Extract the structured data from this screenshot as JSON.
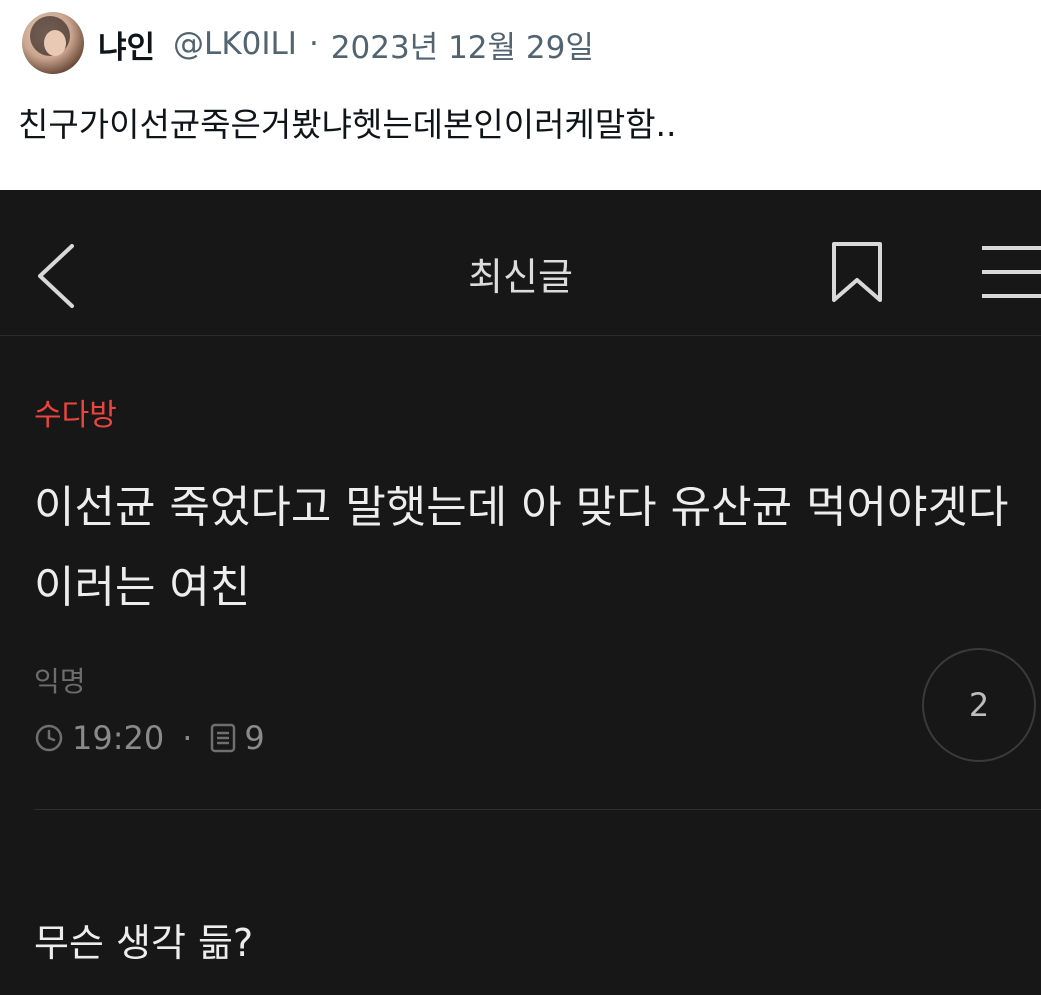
{
  "tweet": {
    "name": "냐인",
    "handle": "@LK0ILI",
    "separator": "·",
    "date": "2023년 12월 29일",
    "text": "친구가이선균죽은거봤냐헷는데본인이러케말함.."
  },
  "app": {
    "header_title": "최신글",
    "post": {
      "category": "수다방",
      "title": "이선균 죽었다고 말햇는데 아 맞다 유산균 먹어야겟다 이러는 여친",
      "author": "익명",
      "time": "19:20",
      "meta_separator": "·",
      "views": "9",
      "comment_count": "2",
      "body": "무슨 생각 듦?"
    },
    "colors": {
      "background": "#171717",
      "category": "#e8453f"
    }
  }
}
